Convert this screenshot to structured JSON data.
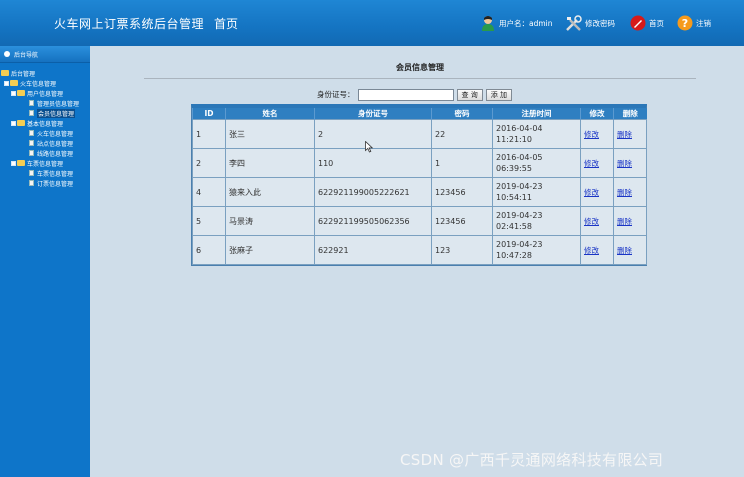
{
  "header": {
    "system_title": "火车网上订票系统后台管理",
    "home": "首页",
    "user_label": "用户名：admin",
    "change_password": "修改密码",
    "homepage": "首页",
    "logout": "注销"
  },
  "sidebar": {
    "title": "后台导航",
    "tree": [
      {
        "label": "后台管理",
        "level": 0
      },
      {
        "label": "火车信息管理",
        "level": 1
      },
      {
        "label": "用户信息管理",
        "level": 2
      },
      {
        "label": "管理员信息管理",
        "level": 3
      },
      {
        "label": "会员信息管理",
        "level": 3
      },
      {
        "label": "基本信息管理",
        "level": 2
      },
      {
        "label": "火车信息管理",
        "level": 3
      },
      {
        "label": "站点信息管理",
        "level": 3
      },
      {
        "label": "线路信息管理",
        "level": 3
      },
      {
        "label": "车票信息管理",
        "level": 2
      },
      {
        "label": "车票信息管理",
        "level": 3
      },
      {
        "label": "订票信息管理",
        "level": 3
      }
    ]
  },
  "main": {
    "heading": "会员信息管理",
    "search_label": "身份证号：",
    "search_value": "",
    "query_button": "查 询",
    "add_button": "添 加",
    "columns": [
      "ID",
      "姓名",
      "身份证号",
      "密码",
      "注册时间",
      "修改",
      "删除"
    ],
    "rows": [
      {
        "id": "1",
        "name": "张三",
        "idcard": "2",
        "password": "22",
        "time": "2016-04-04",
        "time2": "11:21:10",
        "edit": "修改",
        "del": "删除"
      },
      {
        "id": "2",
        "name": "李四",
        "idcard": "110",
        "password": "1",
        "time": "2016-04-05",
        "time2": "06:39:55",
        "edit": "修改",
        "del": "删除"
      },
      {
        "id": "4",
        "name": "猿来入此",
        "idcard": "622921199005222621",
        "password": "123456",
        "time": "2019-04-23",
        "time2": "10:54:11",
        "edit": "修改",
        "del": "删除"
      },
      {
        "id": "5",
        "name": "马景涛",
        "idcard": "622921199505062356",
        "password": "123456",
        "time": "2019-04-23",
        "time2": "02:41:58",
        "edit": "修改",
        "del": "删除"
      },
      {
        "id": "6",
        "name": "张麻子",
        "idcard": "622921",
        "password": "123",
        "time": "2019-04-23",
        "time2": "10:47:28",
        "edit": "修改",
        "del": "删除"
      }
    ]
  },
  "watermark": "CSDN @广西千灵通网络科技有限公司"
}
